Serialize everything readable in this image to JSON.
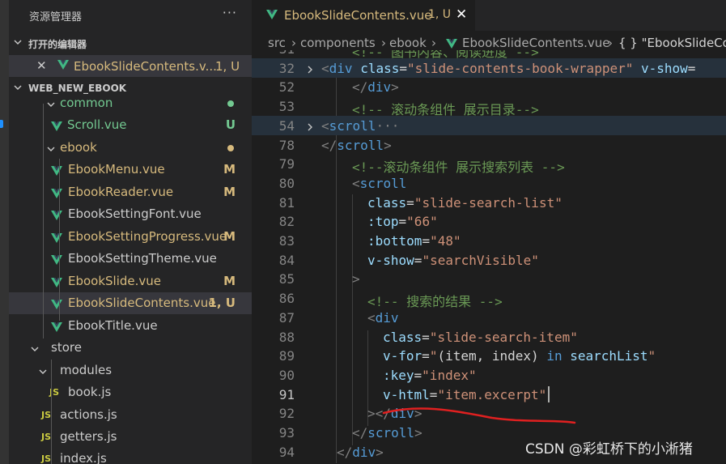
{
  "explorer": {
    "title": "资源管理器",
    "more_glyph": "···",
    "open_editors_label": "打开的编辑器",
    "open_file": {
      "name": "EbookSlideContents.v...",
      "status": "1, U"
    },
    "project_label": "WEB_NEW_EBOOK",
    "tree": [
      {
        "name": "common",
        "color": "#73c991",
        "status": "",
        "kind": "folder"
      },
      {
        "name": "Scroll.vue",
        "color": "#73c991",
        "status": "U",
        "kind": "vue"
      },
      {
        "name": "ebook",
        "color": "#d7ba7d",
        "status": "",
        "kind": "folder"
      },
      {
        "name": "EbookMenu.vue",
        "color": "#d7ba7d",
        "status": "M",
        "kind": "vue"
      },
      {
        "name": "EbookReader.vue",
        "color": "#d7ba7d",
        "status": "M",
        "kind": "vue"
      },
      {
        "name": "EbookSettingFont.vue",
        "color": "#cccccc",
        "status": "",
        "kind": "vue"
      },
      {
        "name": "EbookSettingProgress.vue",
        "color": "#d7ba7d",
        "status": "M",
        "kind": "vue"
      },
      {
        "name": "EbookSettingTheme.vue",
        "color": "#cccccc",
        "status": "",
        "kind": "vue"
      },
      {
        "name": "EbookSlide.vue",
        "color": "#d7ba7d",
        "status": "M",
        "kind": "vue"
      },
      {
        "name": "EbookSlideContents.vue",
        "color": "#d7ba7d",
        "status": "1, U",
        "kind": "vue"
      },
      {
        "name": "EbookTitle.vue",
        "color": "#cccccc",
        "status": "",
        "kind": "vue"
      },
      {
        "name": "store",
        "color": "#cccccc",
        "status": "",
        "kind": "folder"
      },
      {
        "name": "modules",
        "color": "#cccccc",
        "status": "",
        "kind": "folder"
      },
      {
        "name": "book.js",
        "color": "#cccccc",
        "status": "",
        "kind": "js"
      },
      {
        "name": "actions.js",
        "color": "#cccccc",
        "status": "",
        "kind": "js"
      },
      {
        "name": "getters.js",
        "color": "#cccccc",
        "status": "",
        "kind": "js"
      },
      {
        "name": "index.js",
        "color": "#cccccc",
        "status": "",
        "kind": "js"
      }
    ]
  },
  "tab": {
    "name": "EbookSlideContents.vue",
    "status": "1, U"
  },
  "breadcrumb": [
    "src",
    "components",
    "ebook",
    "EbookSlideContents.vue",
    "{ } \"EbookSlideCo"
  ],
  "code_lines": [
    {
      "n": "31",
      "tokens": [
        [
          "cm",
          "<!-- 图书内容、阅读进度 -->"
        ]
      ]
    },
    {
      "n": "32",
      "tokens": [
        [
          "br",
          "<"
        ],
        [
          "tag",
          "div"
        ],
        [
          "pl",
          " "
        ],
        [
          "at",
          "class"
        ],
        [
          "pl",
          "="
        ],
        [
          "st",
          "\"slide-contents-book-wrapper\""
        ],
        [
          "pl",
          " "
        ],
        [
          "at",
          "v-show"
        ],
        [
          "pl",
          "="
        ]
      ]
    },
    {
      "n": "52",
      "tokens": [
        [
          "br",
          "</"
        ],
        [
          "tag",
          "div"
        ],
        [
          "br",
          ">"
        ]
      ]
    },
    {
      "n": "53",
      "tokens": [
        [
          "cm",
          "<!-- 滚动条组件 展示目录-->"
        ]
      ]
    },
    {
      "n": "54",
      "tokens": [
        [
          "br",
          "<"
        ],
        [
          "tag",
          "scroll"
        ],
        [
          "dim",
          "···"
        ]
      ]
    },
    {
      "n": "78",
      "tokens": [
        [
          "br",
          "</"
        ],
        [
          "tag",
          "scroll"
        ],
        [
          "br",
          ">"
        ]
      ]
    },
    {
      "n": "79",
      "tokens": [
        [
          "cm",
          "<!--滚动条组件 展示搜索列表 -->"
        ]
      ]
    },
    {
      "n": "80",
      "tokens": [
        [
          "br",
          "<"
        ],
        [
          "tag",
          "scroll"
        ]
      ]
    },
    {
      "n": "81",
      "tokens": [
        [
          "at",
          "class"
        ],
        [
          "pl",
          "="
        ],
        [
          "st",
          "\"slide-search-list\""
        ]
      ]
    },
    {
      "n": "82",
      "tokens": [
        [
          "at",
          ":top"
        ],
        [
          "pl",
          "="
        ],
        [
          "st",
          "\"66\""
        ]
      ]
    },
    {
      "n": "83",
      "tokens": [
        [
          "at",
          ":bottom"
        ],
        [
          "pl",
          "="
        ],
        [
          "st",
          "\"48\""
        ]
      ]
    },
    {
      "n": "84",
      "tokens": [
        [
          "at",
          "v-show"
        ],
        [
          "pl",
          "="
        ],
        [
          "st",
          "\"searchVisible\""
        ]
      ]
    },
    {
      "n": "85",
      "tokens": [
        [
          "br",
          ">"
        ]
      ]
    },
    {
      "n": "86",
      "tokens": [
        [
          "cm",
          "<!-- 搜索的结果 -->"
        ]
      ]
    },
    {
      "n": "87",
      "tokens": [
        [
          "br",
          "<"
        ],
        [
          "tag",
          "div"
        ]
      ]
    },
    {
      "n": "88",
      "tokens": [
        [
          "at",
          "class"
        ],
        [
          "pl",
          "="
        ],
        [
          "st",
          "\"slide-search-item\""
        ]
      ]
    },
    {
      "n": "89",
      "tokens": [
        [
          "at",
          "v-for"
        ],
        [
          "pl",
          "="
        ],
        [
          "st",
          "\""
        ],
        [
          "pl",
          "(item, index)"
        ],
        [
          "kw",
          " in "
        ],
        [
          "at",
          "searchList"
        ],
        [
          "st",
          "\""
        ]
      ]
    },
    {
      "n": "90",
      "tokens": [
        [
          "at",
          ":key"
        ],
        [
          "pl",
          "="
        ],
        [
          "st",
          "\"index\""
        ]
      ]
    },
    {
      "n": "91",
      "tokens": [
        [
          "at",
          "v-html"
        ],
        [
          "pl",
          "="
        ],
        [
          "st",
          "\"item.excerpt\""
        ]
      ]
    },
    {
      "n": "92",
      "tokens": [
        [
          "br",
          "></"
        ],
        [
          "tag",
          "div"
        ],
        [
          "br",
          ">"
        ]
      ]
    },
    {
      "n": "93",
      "tokens": [
        [
          "br",
          "</"
        ],
        [
          "tag",
          "scroll"
        ],
        [
          "br",
          ">"
        ]
      ]
    },
    {
      "n": "94",
      "tokens": [
        [
          "br",
          "</"
        ],
        [
          "tag",
          "div"
        ],
        [
          "br",
          ">"
        ]
      ]
    }
  ],
  "watermark": "CSDN @彩虹桥下的小淅猪",
  "colors": {
    "vue_green": "#41b883",
    "modified": "#d7ba7d",
    "untracked": "#73c991",
    "annotation_red": "#e02020"
  }
}
